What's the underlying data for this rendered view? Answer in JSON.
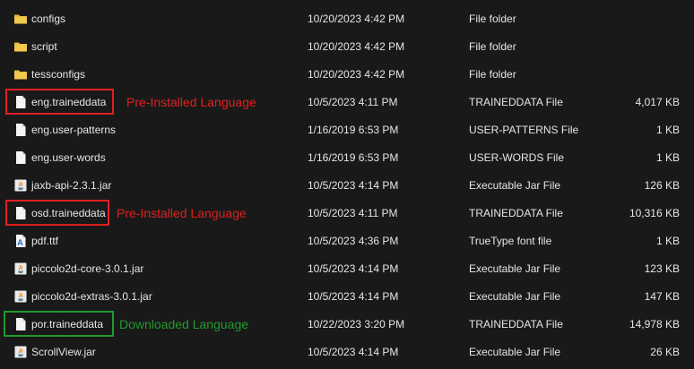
{
  "files": [
    {
      "icon": "folder-icon",
      "name": "configs",
      "date": "10/20/2023 4:42 PM",
      "type": "File folder",
      "size": ""
    },
    {
      "icon": "folder-icon",
      "name": "script",
      "date": "10/20/2023 4:42 PM",
      "type": "File folder",
      "size": ""
    },
    {
      "icon": "folder-icon",
      "name": "tessconfigs",
      "date": "10/20/2023 4:42 PM",
      "type": "File folder",
      "size": ""
    },
    {
      "icon": "document-icon",
      "name": "eng.traineddata",
      "date": "10/5/2023 4:11 PM",
      "type": "TRAINEDDATA File",
      "size": "4,017 KB",
      "annotation": "Pre-Installed Language"
    },
    {
      "icon": "document-icon",
      "name": "eng.user-patterns",
      "date": "1/16/2019 6:53 PM",
      "type": "USER-PATTERNS File",
      "size": "1 KB"
    },
    {
      "icon": "document-icon",
      "name": "eng.user-words",
      "date": "1/16/2019 6:53 PM",
      "type": "USER-WORDS File",
      "size": "1 KB"
    },
    {
      "icon": "jar-icon",
      "name": "jaxb-api-2.3.1.jar",
      "date": "10/5/2023 4:14 PM",
      "type": "Executable Jar File",
      "size": "126 KB"
    },
    {
      "icon": "document-icon",
      "name": "osd.traineddata",
      "date": "10/5/2023 4:11 PM",
      "type": "TRAINEDDATA File",
      "size": "10,316 KB",
      "annotation": "Pre-Installed Language"
    },
    {
      "icon": "font-file-icon",
      "name": "pdf.ttf",
      "date": "10/5/2023 4:36 PM",
      "type": "TrueType font file",
      "size": "1 KB"
    },
    {
      "icon": "jar-icon",
      "name": "piccolo2d-core-3.0.1.jar",
      "date": "10/5/2023 4:14 PM",
      "type": "Executable Jar File",
      "size": "123 KB"
    },
    {
      "icon": "jar-icon",
      "name": "piccolo2d-extras-3.0.1.jar",
      "date": "10/5/2023 4:14 PM",
      "type": "Executable Jar File",
      "size": "147 KB"
    },
    {
      "icon": "document-icon",
      "name": "por.traineddata",
      "date": "10/22/2023 3:20 PM",
      "type": "TRAINEDDATA File",
      "size": "14,978 KB",
      "annotation": "Downloaded Language"
    },
    {
      "icon": "jar-icon",
      "name": "ScrollView.jar",
      "date": "10/5/2023 4:14 PM",
      "type": "Executable Jar File",
      "size": "26 KB"
    }
  ],
  "colors": {
    "background": "#191919",
    "text": "#e6e6e6",
    "folder": "#e8b739",
    "pre_installed_annotation": "#e02020",
    "downloaded_annotation": "#1f9a2e"
  }
}
